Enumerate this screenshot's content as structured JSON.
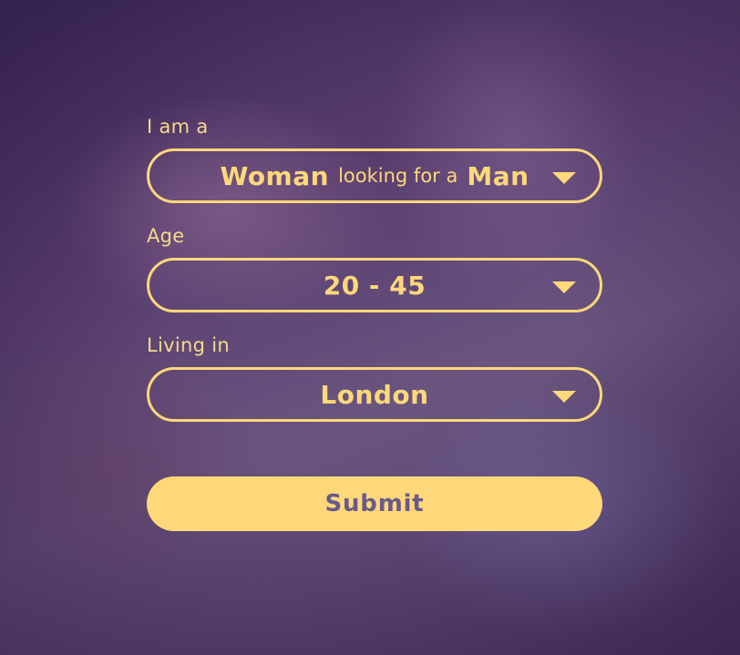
{
  "form": {
    "gender": {
      "label": "I am a",
      "own": "Woman",
      "connector": "looking for a",
      "seeking": "Man",
      "caret_icon": "triangle-down-icon"
    },
    "age": {
      "label": "Age",
      "value": "20 - 45",
      "caret_icon": "triangle-down-icon"
    },
    "location": {
      "label": "Living in",
      "value": "London",
      "caret_icon": "triangle-down-icon"
    },
    "submit_label": "Submit"
  },
  "colors": {
    "accent": "#ffd87a",
    "label": "#f6d98a",
    "button_text": "#6a5a8a",
    "background": "#4a3566"
  }
}
